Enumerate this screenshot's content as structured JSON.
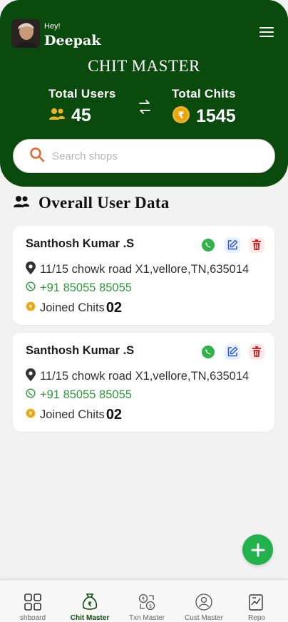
{
  "header": {
    "greeting": "Hey!",
    "user_name": "Deepak",
    "app_title": "CHIT MASTER",
    "stats": {
      "users_label": "Total Users",
      "users_value": "45",
      "chits_label": "Total Chits",
      "chits_value": "1545"
    }
  },
  "search": {
    "placeholder": "Search shops"
  },
  "section": {
    "title": "Overall User Data"
  },
  "cards": [
    {
      "name": "Santhosh Kumar .S",
      "address": "11/15 chowk road X1,vellore,TN,635014",
      "phone": "+91 85055 85055",
      "joined_label": "Joined Chits",
      "joined_count": "02"
    },
    {
      "name": "Santhosh Kumar .S",
      "address": "11/15 chowk road X1,vellore,TN,635014",
      "phone": "+91 85055 85055",
      "joined_label": "Joined Chits",
      "joined_count": "02"
    }
  ],
  "nav": {
    "items": [
      {
        "label": "shboard",
        "icon": "grid-icon"
      },
      {
        "label": "Chit Master",
        "icon": "money-bag-icon",
        "active": true
      },
      {
        "label": "Txn Master",
        "icon": "exchange-icon"
      },
      {
        "label": "Cust Master",
        "icon": "customer-icon"
      },
      {
        "label": "Repo",
        "icon": "report-icon"
      }
    ]
  },
  "colors": {
    "header_bg": "#0b4a0d",
    "accent_green": "#22b14c",
    "phone_green": "#2e9b3b",
    "coin_gold": "#f0b321"
  }
}
